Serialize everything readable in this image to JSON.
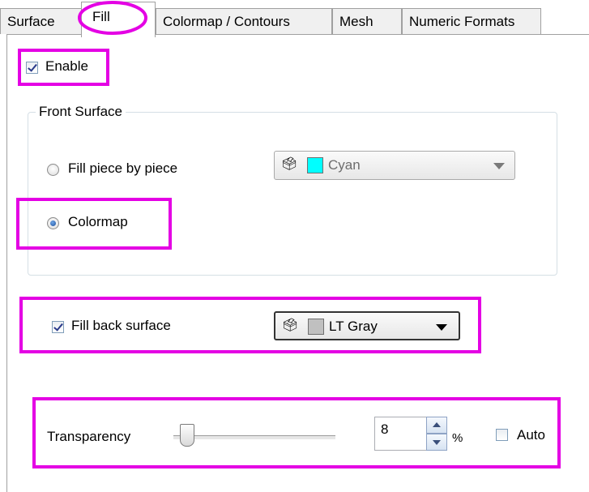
{
  "tabs": [
    {
      "label": "Surface",
      "active": false
    },
    {
      "label": "Fill",
      "active": true
    },
    {
      "label": "Colormap / Contours",
      "active": false
    },
    {
      "label": "Mesh",
      "active": false
    },
    {
      "label": "Numeric Formats",
      "active": false
    }
  ],
  "enable": {
    "label": "Enable",
    "checked": true
  },
  "front_surface": {
    "title": "Front Surface",
    "fill_piece_label": "Fill piece by piece",
    "fill_piece_selected": false,
    "colormap_label": "Colormap",
    "colormap_selected": true,
    "color_combo": {
      "value": "Cyan",
      "swatch_color": "#00ffff",
      "icon": "paint-bucket-icon",
      "enabled": false
    }
  },
  "back_surface": {
    "label": "Fill back surface",
    "checked": true,
    "color_combo": {
      "value": "LT Gray",
      "swatch_color": "#c0c0c0",
      "icon": "paint-bucket-icon",
      "enabled": true
    }
  },
  "transparency": {
    "label": "Transparency",
    "value": "8",
    "unit": "%",
    "slider_fraction": 0.08,
    "auto_label": "Auto",
    "auto_checked": false
  },
  "colors": {
    "highlight": "#e400e4",
    "tab_highlight": "#e400e4"
  }
}
